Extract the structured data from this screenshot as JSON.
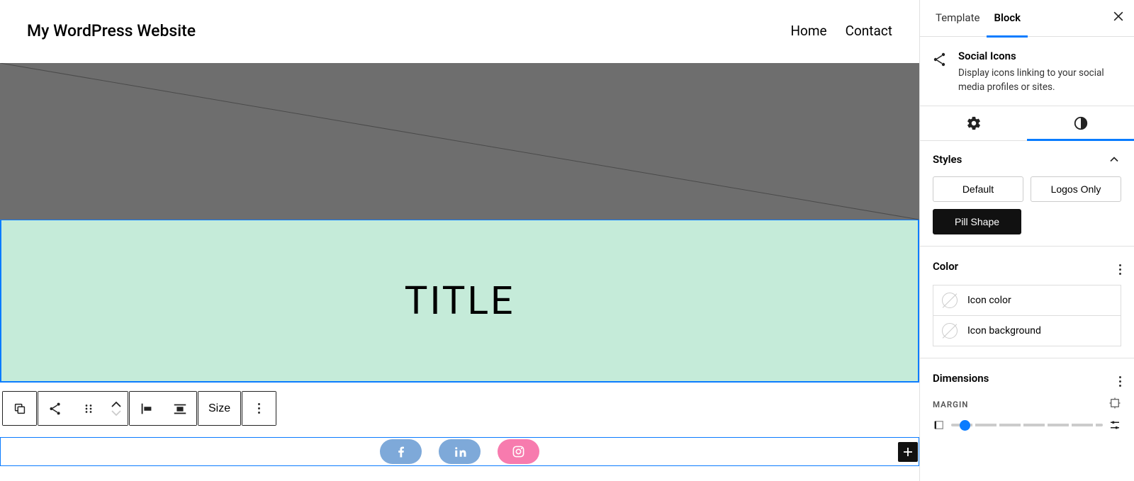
{
  "site": {
    "title": "My WordPress Website"
  },
  "nav": {
    "items": [
      "Home",
      "Contact"
    ]
  },
  "content": {
    "title": "TITLE"
  },
  "toolbar": {
    "size_label": "Size"
  },
  "social": {
    "items": [
      {
        "name": "facebook",
        "bg": "#7ea9d9"
      },
      {
        "name": "linkedin",
        "bg": "#7ea9d9"
      },
      {
        "name": "instagram",
        "bg": "#f77bae"
      }
    ]
  },
  "sidebar": {
    "tabs": {
      "template": "Template",
      "block": "Block"
    },
    "block": {
      "name": "Social Icons",
      "description": "Display icons linking to your social media profiles or sites."
    },
    "panels": {
      "styles": {
        "title": "Styles",
        "options": {
          "default": "Default",
          "logos_only": "Logos Only",
          "pill_shape": "Pill Shape"
        }
      },
      "color": {
        "title": "Color",
        "rows": {
          "icon_color": "Icon color",
          "icon_bg": "Icon background"
        }
      },
      "dimensions": {
        "title": "Dimensions",
        "margin_label": "MARGIN"
      }
    }
  }
}
